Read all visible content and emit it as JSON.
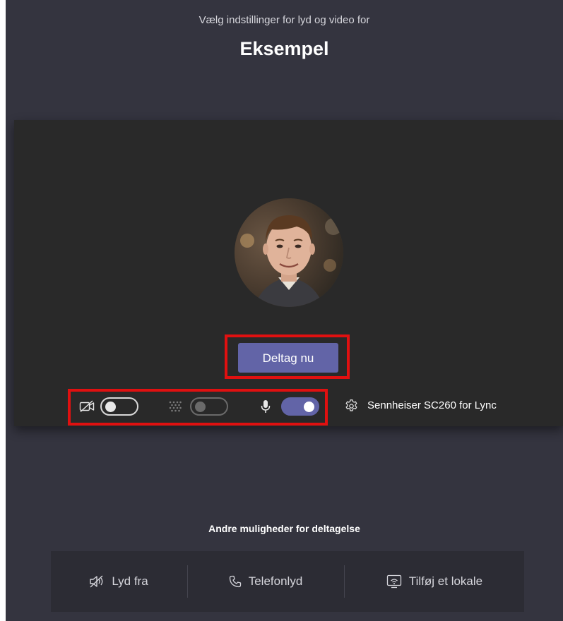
{
  "header": {
    "subtitle": "Vælg indstillinger for lyd og video for",
    "meeting_title": "Eksempel"
  },
  "preview": {
    "join_button_label": "Deltag nu",
    "controls": {
      "camera": {
        "icon": "camera-off-icon",
        "state": "off"
      },
      "background_blur": {
        "icon": "background-blur-icon",
        "state": "off",
        "enabled": false
      },
      "microphone": {
        "icon": "microphone-icon",
        "state": "on"
      }
    },
    "device_settings": {
      "icon": "gear-icon",
      "label": "Sennheiser SC260 for Lync"
    }
  },
  "other_options": {
    "title": "Andre muligheder for deltagelse",
    "items": [
      {
        "icon": "speaker-off-icon",
        "label": "Lyd fra"
      },
      {
        "icon": "phone-icon",
        "label": "Telefonlyd"
      },
      {
        "icon": "room-cast-icon",
        "label": "Tilføj et lokale"
      }
    ]
  },
  "colors": {
    "background": "#34343f",
    "preview_background": "#292929",
    "accent": "#6264a7",
    "highlight": "#e01010"
  }
}
